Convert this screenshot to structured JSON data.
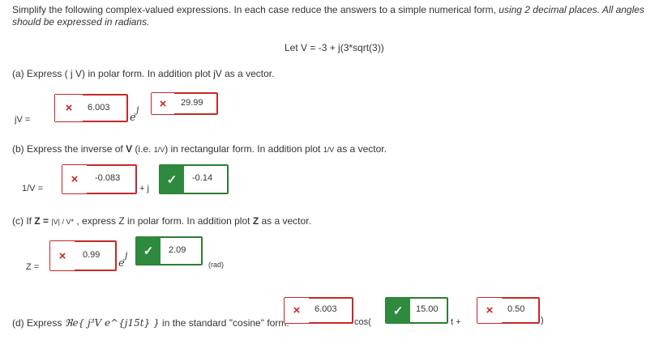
{
  "instructions": {
    "text": "Simplify the following complex-valued expressions. In each case reduce the answers to a simple numerical form, ",
    "emphasis": "using 2 decimal places. All angles should be expressed in radians."
  },
  "given": "Let  V = -3 + j(3*sqrt(3))",
  "part_a": {
    "question": "(a) Express  ( j V)  in polar form.  In addition plot jV as a vector.",
    "lhs": "jV =",
    "magnitude": {
      "value": "6.003",
      "status": "wrong"
    },
    "exp": "e",
    "exp_j": "j",
    "angle": {
      "value": "29.99",
      "status": "wrong"
    }
  },
  "part_b": {
    "question_1": "(b) Express the inverse of ",
    "question_v": "V",
    "question_2": " (i.e. ",
    "question_frac": "1/V",
    "question_3": ") in rectangular form. In addition plot ",
    "question_4": " as a vector.",
    "lhs": "1/V =",
    "real": {
      "value": "-0.083",
      "status": "wrong"
    },
    "plus_j": "+ j",
    "imag": {
      "value": "-0.14",
      "status": "correct"
    }
  },
  "part_c": {
    "question_1": "(c) If ",
    "question_z": "Z = ",
    "question_frac": "|V| / V*",
    "question_2": " , express Z in polar form. In addition plot ",
    "question_z2": "Z",
    "question_3": " as a vector.",
    "lhs": "Z =",
    "magnitude": {
      "value": "0.99",
      "status": "wrong"
    },
    "exp": "e",
    "exp_j": "j",
    "angle": {
      "value": "2.09",
      "status": "correct"
    },
    "unit": "(rad)"
  },
  "part_d": {
    "question": "(d) Express ",
    "math": "ℜe{ j³V e^{j15t} }",
    "question_2": " in the standard \"cosine\" form:",
    "amplitude": {
      "value": "6.003",
      "status": "wrong"
    },
    "cos": "cos(",
    "omega": {
      "value": "15.00",
      "status": "correct"
    },
    "t_plus": "t +",
    "phase": {
      "value": "0.50",
      "status": "wrong"
    },
    "close": ")"
  },
  "icons": {
    "wrong": "×",
    "correct": "✓"
  },
  "colors": {
    "wrong": "#c62828",
    "correct": "#2e8b3e"
  }
}
